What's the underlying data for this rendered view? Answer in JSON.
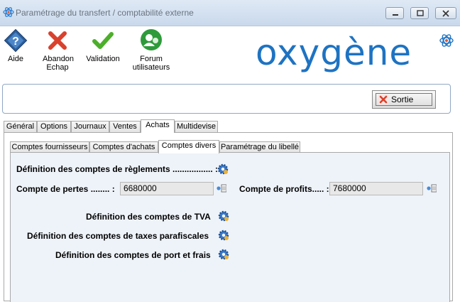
{
  "window": {
    "title": "Paramétrage du transfert / comptabilité externe"
  },
  "toolbar": {
    "aide": "Aide",
    "abandon_line1": "Abandon",
    "abandon_line2": "Echap",
    "validation": "Validation",
    "forum_line1": "Forum",
    "forum_line2": "utilisateurs"
  },
  "logo": {
    "text": "oxygène",
    "color": "#1e73c2"
  },
  "sortie": {
    "label": "Sortie"
  },
  "main_tabs": [
    {
      "label": "Général"
    },
    {
      "label": "Options"
    },
    {
      "label": "Journaux"
    },
    {
      "label": "Ventes"
    },
    {
      "label": "Achats",
      "active": true
    },
    {
      "label": "Multidevise"
    }
  ],
  "sub_tabs": [
    {
      "label": "Comptes fournisseurs"
    },
    {
      "label": "Comptes d'achats"
    },
    {
      "label": "Comptes divers",
      "active": true
    },
    {
      "label": "Paramétrage du libellé"
    }
  ],
  "form": {
    "reglements_label": "Définition des comptes de règlements ................. :",
    "pertes_label": "Compte de pertes ........ :",
    "pertes_value": "6680000",
    "profits_label": "Compte de profits..... :",
    "profits_value": "7680000",
    "tva_label": "Définition des comptes de TVA",
    "taxes_label": "Définition des comptes de taxes parafiscales",
    "port_label": "Définition des comptes de port et frais"
  },
  "colors": {
    "accent": "#1e73c2",
    "panel_bg": "#eef3f9",
    "cancel_red": "#d9412c",
    "validate_green": "#4caf2a",
    "forum_green": "#2e9a3a"
  }
}
